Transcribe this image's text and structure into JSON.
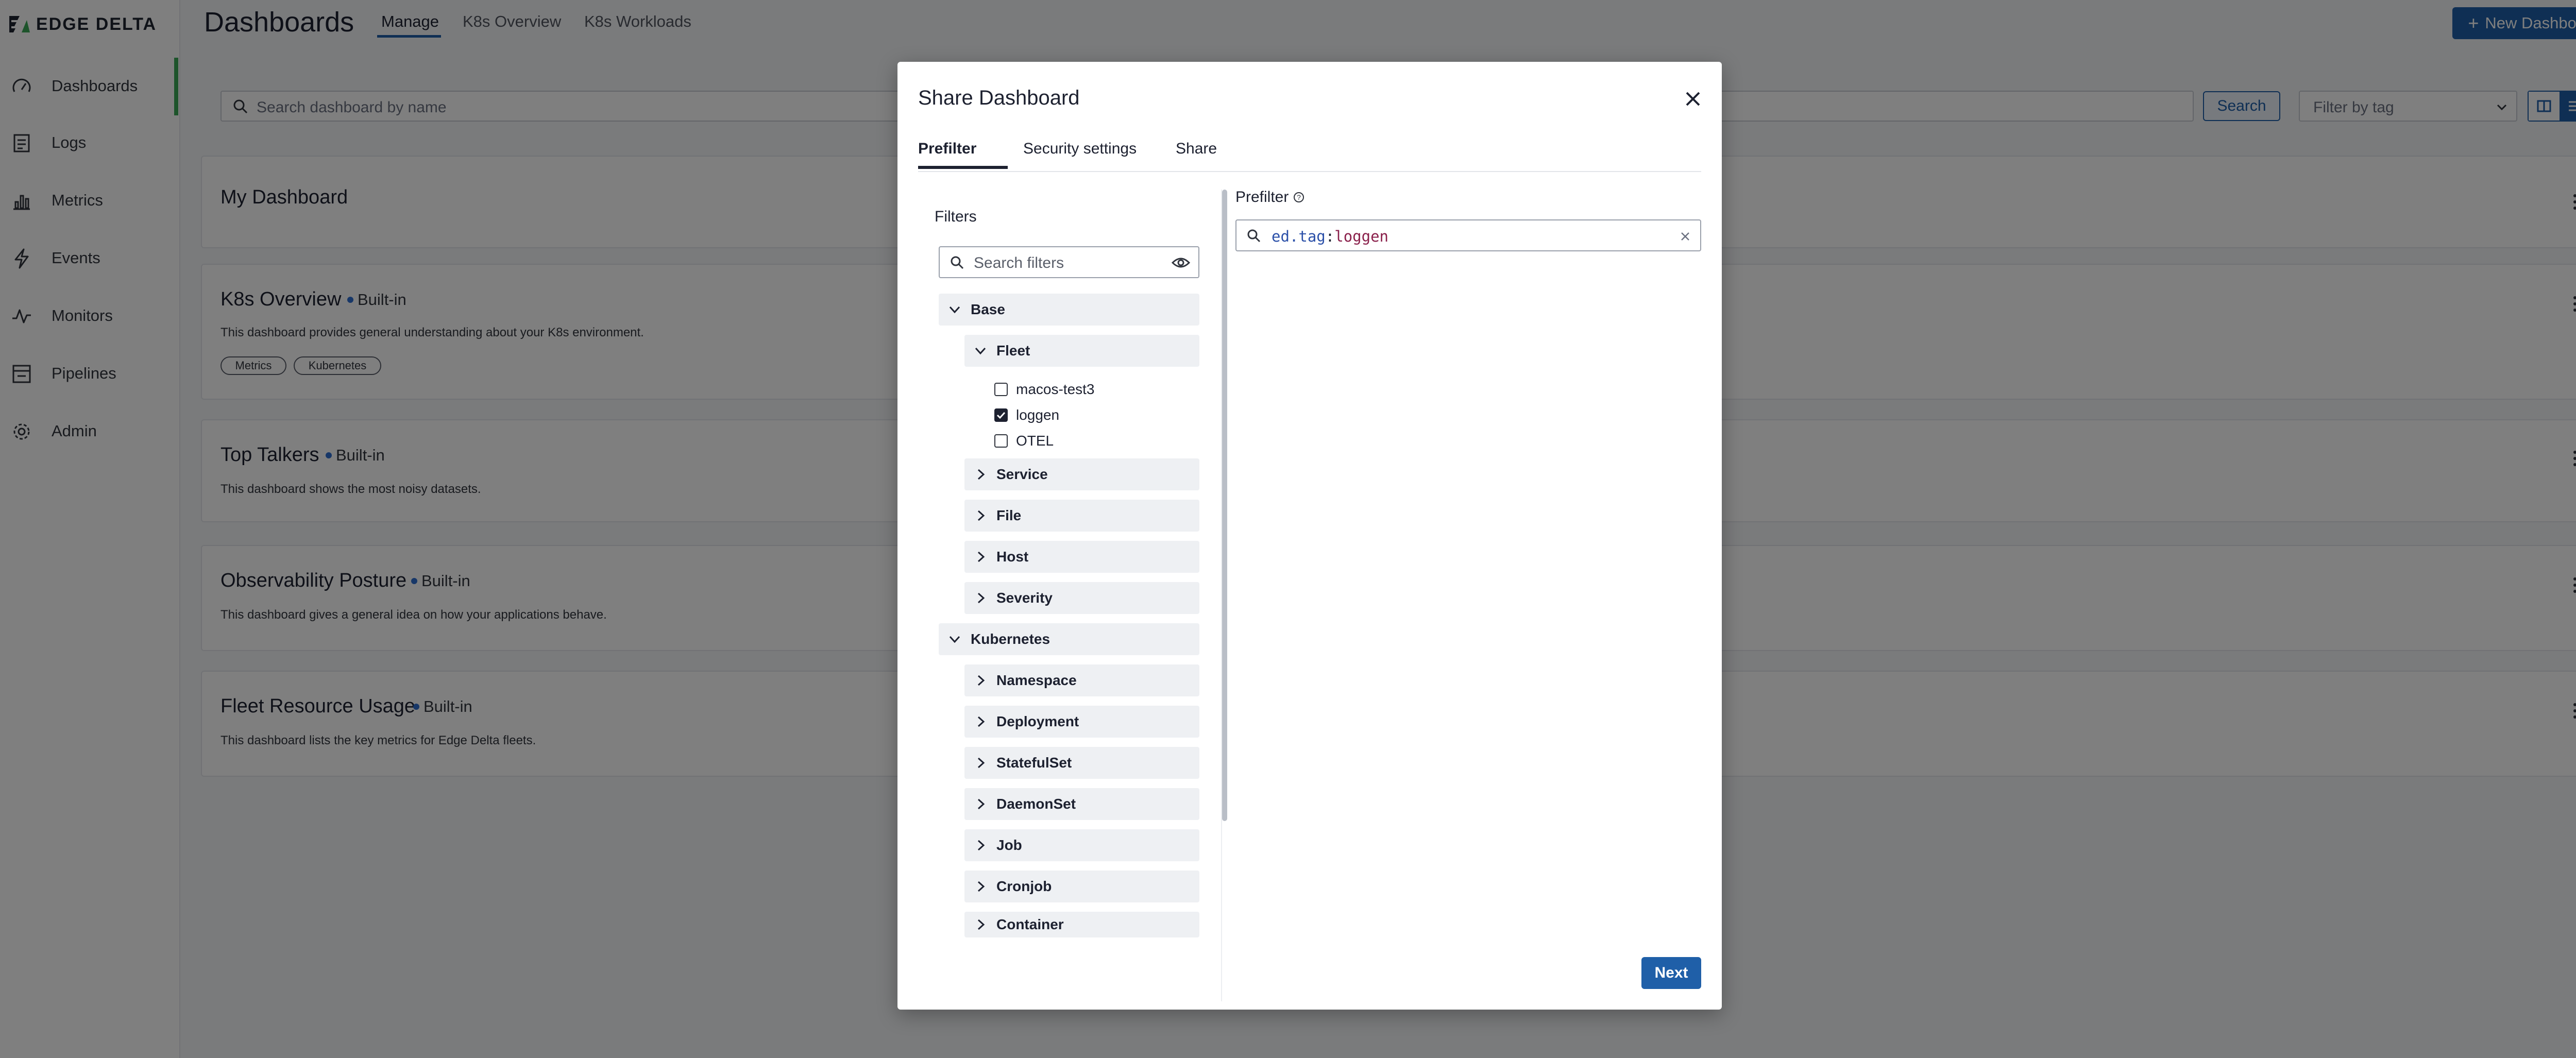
{
  "app": {
    "logo_text": "EDGE DELTA",
    "page_title": "Dashboards",
    "tabs": [
      {
        "label": "Manage",
        "active": true
      },
      {
        "label": "K8s Overview",
        "active": false
      },
      {
        "label": "K8s Workloads",
        "active": false
      }
    ],
    "new_dashboard_label": "New Dashboard"
  },
  "sidebar": {
    "items": [
      {
        "label": "Dashboards",
        "icon": "gauge-icon",
        "active": true
      },
      {
        "label": "Logs",
        "icon": "document-icon"
      },
      {
        "label": "Metrics",
        "icon": "bar-chart-icon"
      },
      {
        "label": "Events",
        "icon": "lightning-icon"
      },
      {
        "label": "Monitors",
        "icon": "pulse-icon"
      },
      {
        "label": "Pipelines",
        "icon": "pipeline-icon"
      },
      {
        "label": "Admin",
        "icon": "gear-icon"
      }
    ]
  },
  "search": {
    "placeholder": "Search dashboard by name",
    "button_label": "Search",
    "filter_placeholder": "Filter by tag"
  },
  "dashboards": [
    {
      "title": "My Dashboard",
      "badge": "",
      "description": "",
      "tags": []
    },
    {
      "title": "K8s Overview",
      "badge": "Built-in",
      "description": "This dashboard provides general understanding about your K8s environment.",
      "tags": [
        "Metrics",
        "Kubernetes"
      ]
    },
    {
      "title": "Top Talkers",
      "badge": "Built-in",
      "description": "This dashboard shows the most noisy datasets.",
      "tags": []
    },
    {
      "title": "Observability Posture",
      "badge": "Built-in",
      "description": "This dashboard gives a general idea on how your applications behave.",
      "tags": []
    },
    {
      "title": "Fleet Resource Usage",
      "badge": "Built-in",
      "description": "This dashboard lists the key metrics for Edge Delta fleets.",
      "tags": []
    }
  ],
  "modal": {
    "title": "Share Dashboard",
    "tabs": [
      {
        "label": "Prefilter",
        "active": true
      },
      {
        "label": "Security settings",
        "active": false
      },
      {
        "label": "Share",
        "active": false
      }
    ],
    "filters_label": "Filters",
    "filters_search_placeholder": "Search filters",
    "groups": {
      "base": "Base",
      "fleet": "Fleet",
      "fleet_items": [
        {
          "label": "macos-test3",
          "checked": false
        },
        {
          "label": "loggen",
          "checked": true
        },
        {
          "label": "OTEL",
          "checked": false
        }
      ],
      "service": "Service",
      "file": "File",
      "host": "Host",
      "severity": "Severity",
      "kubernetes": "Kubernetes",
      "namespace": "Namespace",
      "deployment": "Deployment",
      "statefulset": "StatefulSet",
      "daemonset": "DaemonSet",
      "job": "Job",
      "cronjob": "Cronjob",
      "container": "Container"
    },
    "prefilter_label": "Prefilter",
    "prefilter_query_key": "ed.tag",
    "prefilter_query_sep": ":",
    "prefilter_query_value": "loggen",
    "next_label": "Next"
  },
  "colors": {
    "accent": "#1f5fa8",
    "active_nav": "#3aa856",
    "badge_dot": "#2f6fd0"
  }
}
